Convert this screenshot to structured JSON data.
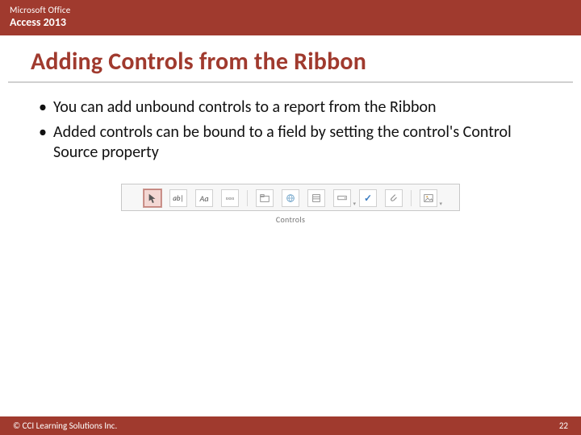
{
  "header": {
    "brand": "Microsoft Office",
    "product": "Access 2013"
  },
  "title": "Adding Controls from the Ribbon",
  "bullets": [
    "You can add unbound controls to a report from the Ribbon",
    "Added controls can be bound to a field by setting the control's Control Source property"
  ],
  "ribbon": {
    "caption": "Controls",
    "icons": [
      {
        "name": "pointer-icon",
        "label": "Select",
        "selected": true
      },
      {
        "name": "textbox-icon",
        "label": "ab|",
        "selected": false
      },
      {
        "name": "label-icon",
        "label": "Aa",
        "selected": false
      },
      {
        "name": "button-icon",
        "label": "xxxx",
        "selected": false
      },
      {
        "name": "tabcontrol-icon",
        "label": "",
        "selected": false
      },
      {
        "name": "hyperlink-icon",
        "label": "",
        "selected": false
      },
      {
        "name": "listbox-icon",
        "label": "",
        "selected": false
      },
      {
        "name": "combobox-icon",
        "label": "",
        "selected": false
      },
      {
        "name": "checkbox-icon",
        "label": "✓",
        "selected": false
      },
      {
        "name": "attachment-icon",
        "label": "",
        "selected": false
      },
      {
        "name": "image-icon",
        "label": "",
        "selected": false
      }
    ]
  },
  "footer": {
    "copyright": "© CCI Learning Solutions Inc.",
    "page": "22"
  }
}
